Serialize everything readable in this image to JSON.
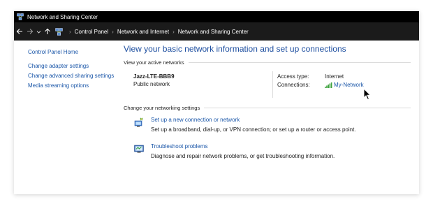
{
  "window": {
    "title": "Network and Sharing Center"
  },
  "address": {
    "breadcrumbs": [
      "Control Panel",
      "Network and Internet",
      "Network and Sharing Center"
    ],
    "separator": "›",
    "back_icon": "arrow-left-icon",
    "forward_icon": "arrow-right-icon",
    "recent_icon": "chevron-down-icon",
    "up_icon": "arrow-up-icon"
  },
  "sidebar": {
    "items": [
      {
        "label": "Control Panel Home"
      },
      {
        "label": "Change adapter settings"
      },
      {
        "label": "Change advanced sharing settings"
      },
      {
        "label": "Media streaming options"
      }
    ]
  },
  "main": {
    "title": "View your basic network information and set up connections",
    "active_networks_heading": "View your active networks",
    "network": {
      "name": "Jazz-LTE-BBB9",
      "category": "Public network",
      "access_type_label": "Access type:",
      "access_type_value": "Internet",
      "connections_label": "Connections:",
      "connections_value": "My-Network"
    },
    "change_settings_heading": "Change your networking settings",
    "tasks": [
      {
        "link": "Set up a new connection or network",
        "description": "Set up a broadband, dial-up, or VPN connection; or set up a router or access point."
      },
      {
        "link": "Troubleshoot problems",
        "description": "Diagnose and repair network problems, or get troubleshooting information."
      }
    ]
  },
  "colors": {
    "link": "#1a56a8",
    "title_text": "#1e4fa0",
    "titlebar_bg": "#000000",
    "addressbar_bg": "#1b1b1b",
    "signal_green": "#3fa33f"
  }
}
